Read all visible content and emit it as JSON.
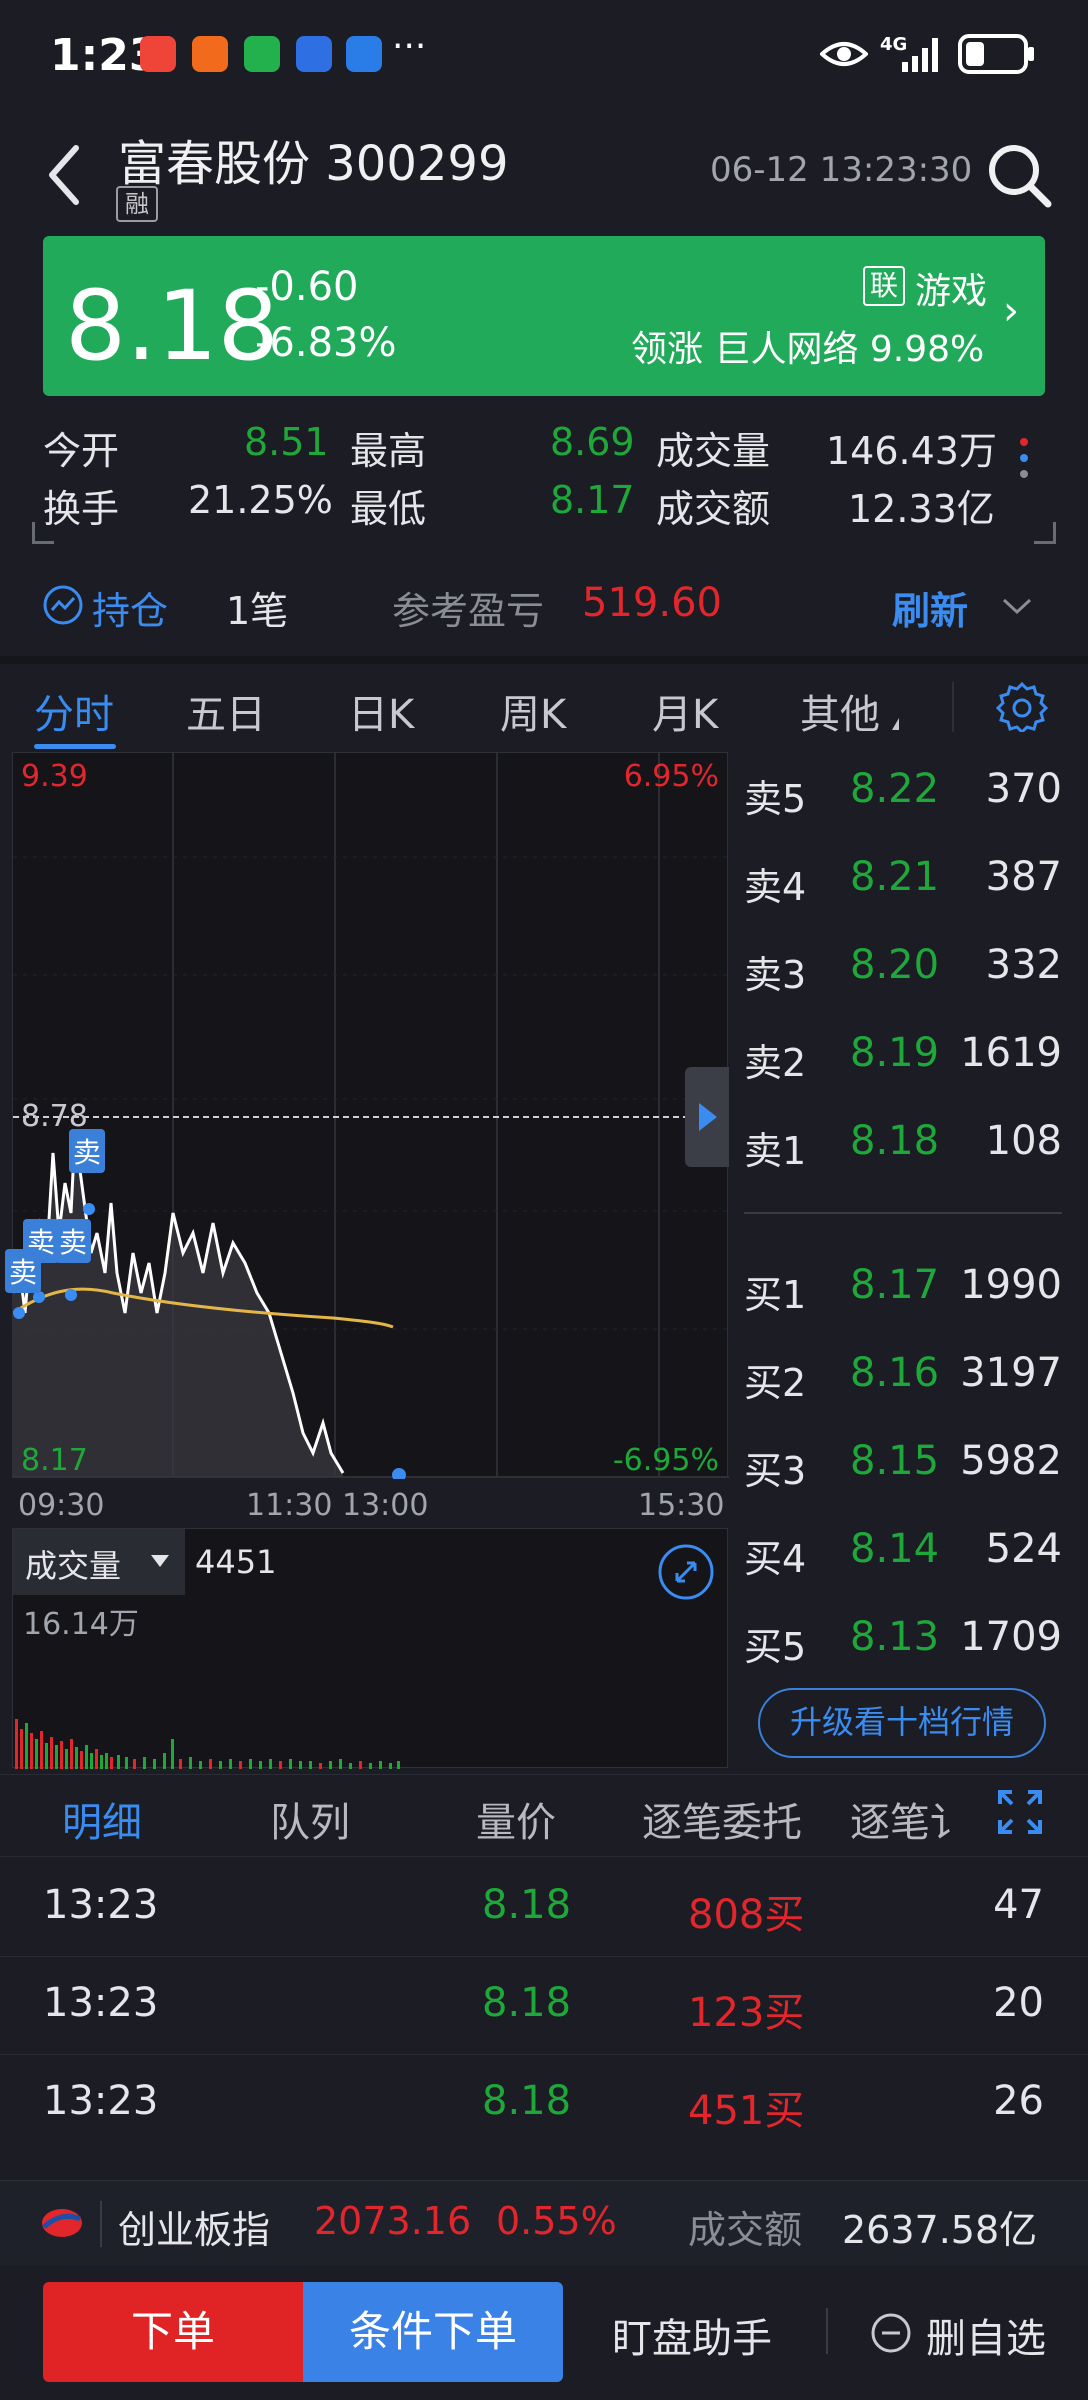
{
  "status_bar": {
    "time": "1:23",
    "more": "···",
    "network": "4G"
  },
  "header": {
    "title": "富春股份 300299",
    "margin_badge": "融",
    "datetime": "06-12 13:23:30"
  },
  "quote": {
    "price": "8.18",
    "change": "-0.60",
    "change_pct": "-6.83%",
    "sector_badge": "联",
    "sector": "游戏",
    "leader": "领涨 巨人网络 9.98%"
  },
  "stats": {
    "open_label": "今开",
    "open": "8.51",
    "high_label": "最高",
    "high": "8.69",
    "volume_label": "成交量",
    "volume": "146.43万",
    "turnover_label": "换手",
    "turnover": "21.25%",
    "low_label": "最低",
    "low": "8.17",
    "amount_label": "成交额",
    "amount": "12.33亿"
  },
  "holding": {
    "label": "持仓",
    "count": "1笔",
    "pnl_label": "参考盈亏",
    "pnl": "519.60",
    "refresh": "刷新"
  },
  "tabs": [
    "分时",
    "五日",
    "日K",
    "周K",
    "月K",
    "其他"
  ],
  "chart": {
    "y_top": "9.39",
    "y_top_pct": "6.95%",
    "y_mid": "8.78",
    "y_bottom": "8.17",
    "y_bottom_pct": "-6.95%",
    "x_labels": [
      "09:30",
      "11:30 13:00",
      "15:30"
    ],
    "sell_marker": "卖",
    "volume_label": "成交量",
    "volume_value": "4451",
    "volume_max": "16.14万"
  },
  "order_book": {
    "asks": [
      {
        "label": "卖5",
        "price": "8.22",
        "vol": "370"
      },
      {
        "label": "卖4",
        "price": "8.21",
        "vol": "387"
      },
      {
        "label": "卖3",
        "price": "8.20",
        "vol": "332"
      },
      {
        "label": "卖2",
        "price": "8.19",
        "vol": "1619"
      },
      {
        "label": "卖1",
        "price": "8.18",
        "vol": "108"
      }
    ],
    "bids": [
      {
        "label": "买1",
        "price": "8.17",
        "vol": "1990"
      },
      {
        "label": "买2",
        "price": "8.16",
        "vol": "3197"
      },
      {
        "label": "买3",
        "price": "8.15",
        "vol": "5982"
      },
      {
        "label": "买4",
        "price": "8.14",
        "vol": "524"
      },
      {
        "label": "买5",
        "price": "8.13",
        "vol": "1709"
      }
    ],
    "upgrade": "升级看十档行情"
  },
  "detail_tabs": [
    "明细",
    "队列",
    "量价",
    "逐笔委托",
    "逐笔讠"
  ],
  "trades": [
    {
      "time": "13:23",
      "price": "8.18",
      "order": "808买",
      "vol": "47"
    },
    {
      "time": "13:23",
      "price": "8.18",
      "order": "123买",
      "vol": "20"
    },
    {
      "time": "13:23",
      "price": "8.18",
      "order": "451买",
      "vol": "26"
    }
  ],
  "index": {
    "name": "创业板指",
    "value": "2073.16",
    "pct": "0.55%",
    "amount_label": "成交额",
    "amount": "2637.58亿"
  },
  "bottom": {
    "order": "下单",
    "cond_order": "条件下单",
    "assistant": "盯盘助手",
    "remove": "删自选"
  },
  "colors": {
    "up": "#e3262b",
    "down": "#1fa83a",
    "accent": "#3a8cf0",
    "banner": "#20aa5a"
  }
}
